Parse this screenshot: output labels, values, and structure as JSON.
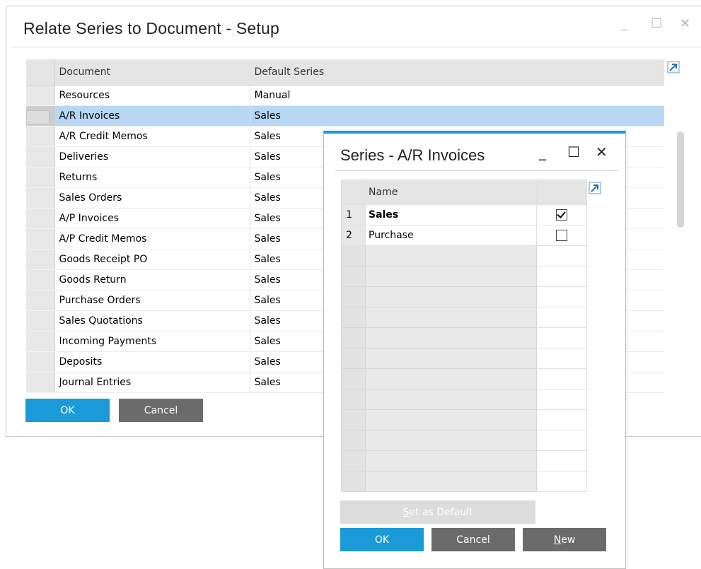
{
  "main_window": {
    "title": "Relate Series to Document - Setup",
    "controls": {
      "minimize": "_",
      "maximize": "☐",
      "close": "✕"
    },
    "grid": {
      "columns": [
        "Document",
        "Default Series"
      ],
      "rows": [
        {
          "document": "Resources",
          "series": "Manual"
        },
        {
          "document": "A/R Invoices",
          "series": "Sales",
          "selected": true
        },
        {
          "document": "A/R Credit Memos",
          "series": "Sales"
        },
        {
          "document": "Deliveries",
          "series": "Sales"
        },
        {
          "document": "Returns",
          "series": "Sales"
        },
        {
          "document": "Sales Orders",
          "series": "Sales"
        },
        {
          "document": "A/P Invoices",
          "series": "Sales"
        },
        {
          "document": "A/P Credit Memos",
          "series": "Sales"
        },
        {
          "document": "Goods Receipt PO",
          "series": "Sales"
        },
        {
          "document": "Goods Return",
          "series": "Sales"
        },
        {
          "document": "Purchase Orders",
          "series": "Sales"
        },
        {
          "document": "Sales Quotations",
          "series": "Sales"
        },
        {
          "document": "Incoming Payments",
          "series": "Sales"
        },
        {
          "document": "Deposits",
          "series": "Sales"
        },
        {
          "document": "Journal Entries",
          "series": "Sales"
        }
      ]
    },
    "buttons": {
      "ok": "OK",
      "cancel": "Cancel"
    }
  },
  "popup": {
    "title": "Series - A/R Invoices",
    "controls": {
      "minimize": "_",
      "maximize": "☐",
      "close": "✕"
    },
    "grid": {
      "column_name": "Name",
      "rows": [
        {
          "num": "1",
          "name": "Sales",
          "checked": true
        },
        {
          "num": "2",
          "name": "Purchase",
          "checked": false
        }
      ]
    },
    "set_default": {
      "first": "S",
      "rest": "et as Default"
    },
    "buttons": {
      "ok": "OK",
      "cancel": "Cancel",
      "new_first": "N",
      "new_rest": "ew"
    }
  },
  "colors": {
    "accent": "#1a9ad6",
    "selection": "#b8d7f5",
    "secondary_button": "#6b6b6b"
  },
  "icons": [
    "expand-arrow-icon",
    "checkbox-checked-icon",
    "checkbox-unchecked-icon"
  ]
}
